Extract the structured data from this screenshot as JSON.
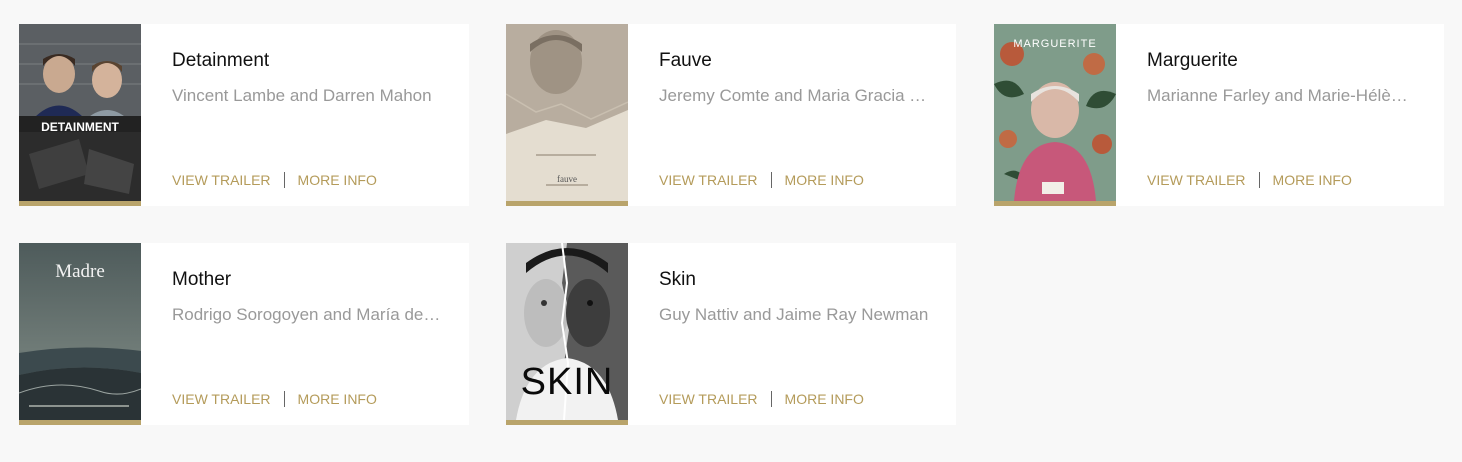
{
  "colors": {
    "accent": "#b49b5a",
    "poster_underline": "#b9a46b",
    "page_bg": "#f8f8f8",
    "card_bg": "#ffffff"
  },
  "films": [
    {
      "title": "Detainment",
      "credits": "Vincent Lambe and Darren Mahon",
      "poster_text": "DETAINMENT",
      "view_trailer": "VIEW TRAILER",
      "more_info": "MORE INFO"
    },
    {
      "title": "Fauve",
      "credits": "Jeremy Comte and Maria Gracia Turgeon",
      "poster_text": "fauve",
      "view_trailer": "VIEW TRAILER",
      "more_info": "MORE INFO"
    },
    {
      "title": "Marguerite",
      "credits": "Marianne Farley and Marie-Hélène Panisset",
      "poster_text": "MARGUERITE",
      "view_trailer": "VIEW TRAILER",
      "more_info": "MORE INFO"
    },
    {
      "title": "Mother",
      "credits": "Rodrigo Sorogoyen and María del Puy Alvarado",
      "poster_text": "Madre",
      "view_trailer": "VIEW TRAILER",
      "more_info": "MORE INFO"
    },
    {
      "title": "Skin",
      "credits": "Guy Nattiv and Jaime Ray Newman",
      "poster_text": "SKIN",
      "view_trailer": "VIEW TRAILER",
      "more_info": "MORE INFO"
    }
  ]
}
